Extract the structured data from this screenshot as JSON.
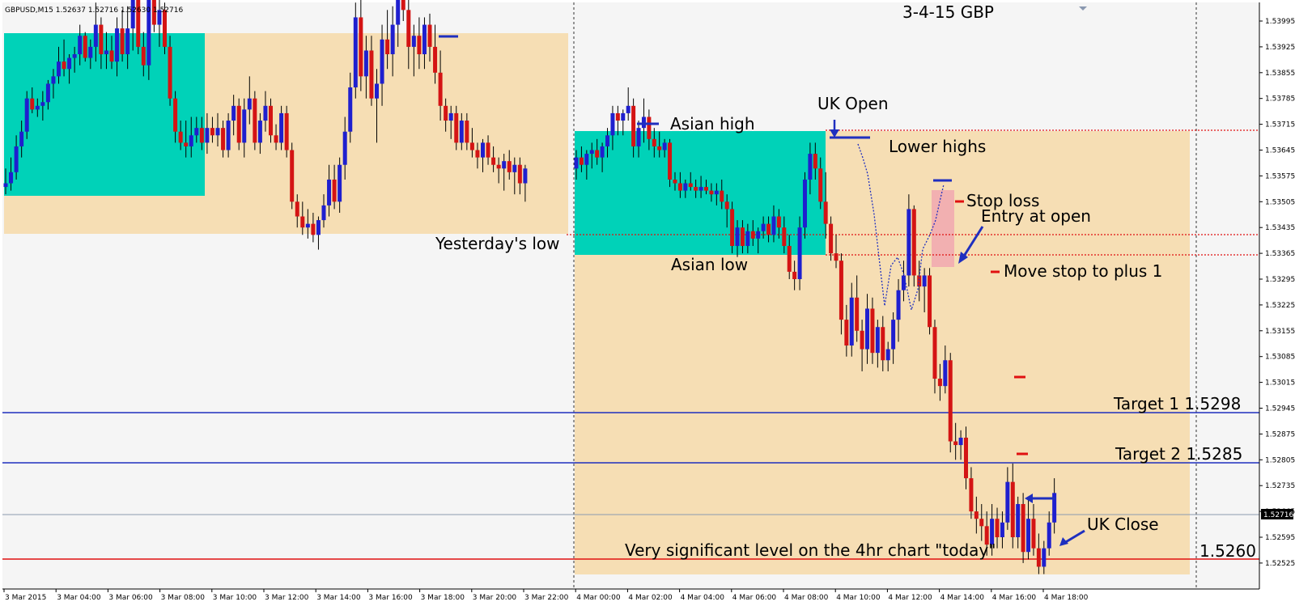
{
  "symbol_info": "GBPUSD,M15  1.52637 1.52716 1.52630 1.52716",
  "chart_title": "3-4-15  GBP",
  "colors": {
    "bull": "#1f1fcf",
    "bear": "#d41414",
    "session": "#00d2b8",
    "range": "#f6deb4",
    "bg": "#f5f5f5"
  },
  "chart_data": {
    "type": "candlestick",
    "timeframe": "M15",
    "ylim": [
      1.5251,
      1.5403
    ],
    "x_ticks": [
      "3 Mar 2015",
      "3 Mar 04:00",
      "3 Mar 06:00",
      "3 Mar 08:00",
      "3 Mar 10:00",
      "3 Mar 12:00",
      "3 Mar 14:00",
      "3 Mar 16:00",
      "3 Mar 18:00",
      "3 Mar 20:00",
      "3 Mar 22:00",
      "4 Mar 00:00",
      "4 Mar 02:00",
      "4 Mar 04:00",
      "4 Mar 06:00",
      "4 Mar 08:00",
      "4 Mar 10:00",
      "4 Mar 12:00",
      "4 Mar 14:00",
      "4 Mar 16:00",
      "4 Mar 18:00"
    ],
    "y_ticks": [
      "1.53995",
      "1.53925",
      "1.53855",
      "1.53785",
      "1.53715",
      "1.53645",
      "1.53575",
      "1.53505",
      "1.53435",
      "1.53365",
      "1.53295",
      "1.53225",
      "1.53155",
      "1.53085",
      "1.53015",
      "1.52945",
      "1.52875",
      "1.52805",
      "1.52735",
      "1.52665",
      "1.52595",
      "1.52525"
    ],
    "current_price": "1.52716",
    "levels": [
      {
        "name": "Target 1",
        "label": "Target 1  1.5298",
        "value": 1.5298
      },
      {
        "name": "Target 2",
        "label": "Target 2  1.5285",
        "value": 1.5285
      },
      {
        "name": "Very significant level",
        "label": "1.5260",
        "value": 1.526
      }
    ],
    "candles_day1": [
      [
        1.5354,
        1.5359,
        1.5352,
        1.5355
      ],
      [
        1.5355,
        1.5362,
        1.5353,
        1.5358
      ],
      [
        1.5358,
        1.5368,
        1.5356,
        1.5365
      ],
      [
        1.5365,
        1.5372,
        1.5362,
        1.5369
      ],
      [
        1.5369,
        1.538,
        1.5367,
        1.5378
      ],
      [
        1.5378,
        1.5381,
        1.5374,
        1.5375
      ],
      [
        1.5375,
        1.5378,
        1.5373,
        1.5376
      ],
      [
        1.5376,
        1.538,
        1.5372,
        1.5377
      ],
      [
        1.5377,
        1.5383,
        1.5375,
        1.5382
      ],
      [
        1.5382,
        1.5386,
        1.5378,
        1.5384
      ],
      [
        1.5384,
        1.5392,
        1.5382,
        1.5388
      ],
      [
        1.5388,
        1.5394,
        1.5384,
        1.5386
      ],
      [
        1.5386,
        1.539,
        1.5382,
        1.5389
      ],
      [
        1.5389,
        1.5392,
        1.5385,
        1.539
      ],
      [
        1.539,
        1.5398,
        1.5387,
        1.5395
      ],
      [
        1.5395,
        1.5396,
        1.5388,
        1.5389
      ],
      [
        1.5389,
        1.5394,
        1.5386,
        1.5392
      ],
      [
        1.5392,
        1.5404,
        1.5388,
        1.5398
      ],
      [
        1.5398,
        1.54,
        1.5386,
        1.539
      ],
      [
        1.539,
        1.5396,
        1.5386,
        1.5391
      ],
      [
        1.5391,
        1.5395,
        1.5386,
        1.5388
      ],
      [
        1.5388,
        1.54,
        1.5384,
        1.5397
      ],
      [
        1.5397,
        1.5402,
        1.5388,
        1.539
      ],
      [
        1.539,
        1.5403,
        1.5386,
        1.5397
      ],
      [
        1.5397,
        1.541,
        1.5391,
        1.5405
      ],
      [
        1.5405,
        1.5408,
        1.539,
        1.5392
      ],
      [
        1.5392,
        1.5396,
        1.5384,
        1.5387
      ],
      [
        1.5387,
        1.5412,
        1.5383,
        1.5408
      ],
      [
        1.5408,
        1.541,
        1.5396,
        1.5398
      ],
      [
        1.5398,
        1.5406,
        1.5392,
        1.5402
      ],
      [
        1.5402,
        1.5404,
        1.539,
        1.5392
      ],
      [
        1.5392,
        1.5395,
        1.5376,
        1.5378
      ],
      [
        1.5378,
        1.538,
        1.5366,
        1.5369
      ],
      [
        1.5369,
        1.5372,
        1.5364,
        1.5366
      ],
      [
        1.5366,
        1.5372,
        1.5362,
        1.5365
      ],
      [
        1.5365,
        1.5373,
        1.5362,
        1.5368
      ],
      [
        1.5368,
        1.5373,
        1.5366,
        1.537
      ],
      [
        1.537,
        1.5373,
        1.5364,
        1.5366
      ],
      [
        1.5366,
        1.5374,
        1.5363,
        1.537
      ],
      [
        1.537,
        1.5373,
        1.5366,
        1.5368
      ],
      [
        1.5368,
        1.5374,
        1.5365,
        1.537
      ],
      [
        1.537,
        1.5372,
        1.5362,
        1.5364
      ],
      [
        1.5364,
        1.5374,
        1.5362,
        1.5372
      ],
      [
        1.5372,
        1.5379,
        1.5368,
        1.5376
      ],
      [
        1.5376,
        1.5378,
        1.5364,
        1.5366
      ],
      [
        1.5366,
        1.5378,
        1.5362,
        1.5375
      ],
      [
        1.5375,
        1.5384,
        1.5371,
        1.5378
      ],
      [
        1.5378,
        1.538,
        1.5364,
        1.5366
      ],
      [
        1.5366,
        1.5374,
        1.5363,
        1.5372
      ],
      [
        1.5372,
        1.538,
        1.5369,
        1.5376
      ],
      [
        1.5376,
        1.5378,
        1.5366,
        1.5368
      ],
      [
        1.5368,
        1.5371,
        1.5364,
        1.5366
      ],
      [
        1.5366,
        1.5376,
        1.5364,
        1.5374
      ],
      [
        1.5374,
        1.5376,
        1.5362,
        1.5364
      ],
      [
        1.5364,
        1.5366,
        1.5348,
        1.535
      ],
      [
        1.535,
        1.5352,
        1.5343,
        1.5346
      ],
      [
        1.5346,
        1.535,
        1.5341,
        1.5343
      ],
      [
        1.5343,
        1.5348,
        1.534,
        1.5344
      ],
      [
        1.5344,
        1.5347,
        1.5339,
        1.5341
      ],
      [
        1.5341,
        1.5346,
        1.5337,
        1.5345
      ],
      [
        1.5345,
        1.5352,
        1.5343,
        1.5349
      ],
      [
        1.5349,
        1.536,
        1.5346,
        1.5356
      ],
      [
        1.5356,
        1.536,
        1.5348,
        1.535
      ],
      [
        1.535,
        1.5362,
        1.5347,
        1.536
      ],
      [
        1.536,
        1.5373,
        1.5356,
        1.5369
      ],
      [
        1.5369,
        1.5385,
        1.5366,
        1.5381
      ],
      [
        1.5381,
        1.5404,
        1.5378,
        1.54
      ],
      [
        1.54,
        1.5405,
        1.538,
        1.5384
      ],
      [
        1.5384,
        1.5395,
        1.5378,
        1.5391
      ],
      [
        1.5391,
        1.5395,
        1.5376,
        1.5378
      ],
      [
        1.5378,
        1.5386,
        1.5366,
        1.5382
      ],
      [
        1.5382,
        1.5398,
        1.5376,
        1.5394
      ],
      [
        1.5394,
        1.5402,
        1.5386,
        1.539
      ],
      [
        1.539,
        1.5403,
        1.5384,
        1.5398
      ],
      [
        1.5398,
        1.5418,
        1.5392,
        1.5414
      ],
      [
        1.5414,
        1.542,
        1.5399,
        1.5402
      ],
      [
        1.5402,
        1.5407,
        1.5386,
        1.5392
      ],
      [
        1.5392,
        1.5398,
        1.5384,
        1.5395
      ],
      [
        1.5395,
        1.54,
        1.5386,
        1.539
      ],
      [
        1.539,
        1.54,
        1.5386,
        1.5398
      ],
      [
        1.5398,
        1.5401,
        1.5388,
        1.5392
      ],
      [
        1.5392,
        1.5398,
        1.5382,
        1.5385
      ],
      [
        1.5385,
        1.5391,
        1.5372,
        1.5376
      ],
      [
        1.5376,
        1.5378,
        1.5369,
        1.5372
      ],
      [
        1.5372,
        1.5376,
        1.5367,
        1.5374
      ],
      [
        1.5374,
        1.5376,
        1.5364,
        1.5366
      ],
      [
        1.5366,
        1.5374,
        1.5364,
        1.5372
      ],
      [
        1.5372,
        1.5374,
        1.5364,
        1.5366
      ],
      [
        1.5366,
        1.537,
        1.5362,
        1.5364
      ],
      [
        1.5364,
        1.5366,
        1.5359,
        1.5362
      ],
      [
        1.5362,
        1.5367,
        1.5358,
        1.5366
      ],
      [
        1.5366,
        1.5368,
        1.536,
        1.5362
      ],
      [
        1.5362,
        1.5365,
        1.5358,
        1.536
      ],
      [
        1.536,
        1.5362,
        1.5355,
        1.5359
      ],
      [
        1.5359,
        1.5363,
        1.5353,
        1.5361
      ],
      [
        1.5361,
        1.5364,
        1.5356,
        1.5358
      ],
      [
        1.5358,
        1.5362,
        1.5352,
        1.536
      ],
      [
        1.536,
        1.5362,
        1.5352,
        1.5355
      ],
      [
        1.5355,
        1.536,
        1.535,
        1.5359
      ]
    ],
    "candles_day2": [
      [
        1.5359,
        1.5364,
        1.5356,
        1.5362
      ],
      [
        1.5362,
        1.5365,
        1.5358,
        1.536
      ],
      [
        1.536,
        1.5364,
        1.5356,
        1.5363
      ],
      [
        1.5363,
        1.5366,
        1.5359,
        1.5364
      ],
      [
        1.5364,
        1.5367,
        1.536,
        1.5362
      ],
      [
        1.5362,
        1.5366,
        1.5358,
        1.5365
      ],
      [
        1.5365,
        1.537,
        1.5362,
        1.5368
      ],
      [
        1.5368,
        1.5376,
        1.5364,
        1.5374
      ],
      [
        1.5374,
        1.5376,
        1.5368,
        1.5372
      ],
      [
        1.5372,
        1.5375,
        1.5368,
        1.5374
      ],
      [
        1.5374,
        1.5381,
        1.5372,
        1.5376
      ],
      [
        1.5376,
        1.5378,
        1.5362,
        1.5365
      ],
      [
        1.5365,
        1.5372,
        1.5362,
        1.537
      ],
      [
        1.537,
        1.5378,
        1.5366,
        1.5373
      ],
      [
        1.5373,
        1.5375,
        1.5364,
        1.5367
      ],
      [
        1.5367,
        1.537,
        1.5362,
        1.5365
      ],
      [
        1.5365,
        1.5369,
        1.5362,
        1.5364
      ],
      [
        1.5364,
        1.5367,
        1.5362,
        1.5366
      ],
      [
        1.5366,
        1.5367,
        1.5354,
        1.5356
      ],
      [
        1.5356,
        1.5358,
        1.5353,
        1.5355
      ],
      [
        1.5355,
        1.5358,
        1.5351,
        1.5353
      ],
      [
        1.5353,
        1.5356,
        1.5351,
        1.5355
      ],
      [
        1.5355,
        1.5358,
        1.5353,
        1.5354
      ],
      [
        1.5354,
        1.5356,
        1.5351,
        1.5353
      ],
      [
        1.5353,
        1.5357,
        1.5351,
        1.5354
      ],
      [
        1.5354,
        1.5356,
        1.5352,
        1.5353
      ],
      [
        1.5353,
        1.5355,
        1.535,
        1.5352
      ],
      [
        1.5352,
        1.5355,
        1.5349,
        1.5353
      ],
      [
        1.5353,
        1.5356,
        1.5348,
        1.535
      ],
      [
        1.535,
        1.5352,
        1.5343,
        1.5348
      ],
      [
        1.5348,
        1.535,
        1.5336,
        1.5338
      ],
      [
        1.5338,
        1.5345,
        1.5335,
        1.5343
      ],
      [
        1.5343,
        1.5345,
        1.5336,
        1.5338
      ],
      [
        1.5338,
        1.5344,
        1.5336,
        1.5342
      ],
      [
        1.5342,
        1.5345,
        1.5338,
        1.534
      ],
      [
        1.534,
        1.5343,
        1.5336,
        1.5342
      ],
      [
        1.5342,
        1.5346,
        1.534,
        1.5344
      ],
      [
        1.5344,
        1.5346,
        1.5339,
        1.5341
      ],
      [
        1.5341,
        1.5349,
        1.5339,
        1.5346
      ],
      [
        1.5346,
        1.5348,
        1.534,
        1.5343
      ],
      [
        1.5343,
        1.5346,
        1.5336,
        1.5338
      ],
      [
        1.5338,
        1.5341,
        1.5329,
        1.5331
      ],
      [
        1.5331,
        1.5334,
        1.5326,
        1.5329
      ],
      [
        1.5329,
        1.5346,
        1.5326,
        1.5343
      ],
      [
        1.5343,
        1.5358,
        1.534,
        1.5356
      ],
      [
        1.5356,
        1.5366,
        1.5352,
        1.5363
      ],
      [
        1.5363,
        1.5366,
        1.5356,
        1.5359
      ],
      [
        1.5359,
        1.5362,
        1.5348,
        1.535
      ],
      [
        1.535,
        1.5358,
        1.534,
        1.5344
      ],
      [
        1.5344,
        1.5346,
        1.5334,
        1.5336
      ],
      [
        1.5336,
        1.5341,
        1.5332,
        1.5334
      ],
      [
        1.5334,
        1.5336,
        1.5314,
        1.5318
      ],
      [
        1.5318,
        1.5322,
        1.5308,
        1.5311
      ],
      [
        1.5311,
        1.5328,
        1.5308,
        1.5324
      ],
      [
        1.5324,
        1.533,
        1.5312,
        1.5315
      ],
      [
        1.5315,
        1.5318,
        1.5304,
        1.531
      ],
      [
        1.531,
        1.5325,
        1.5306,
        1.5321
      ],
      [
        1.5321,
        1.5324,
        1.5306,
        1.5309
      ],
      [
        1.5309,
        1.5318,
        1.5305,
        1.5316
      ],
      [
        1.5316,
        1.5319,
        1.5304,
        1.5307
      ],
      [
        1.5307,
        1.5312,
        1.5304,
        1.531
      ],
      [
        1.531,
        1.532,
        1.5306,
        1.5318
      ],
      [
        1.5318,
        1.5329,
        1.5312,
        1.5326
      ],
      [
        1.5326,
        1.5334,
        1.5323,
        1.533
      ],
      [
        1.533,
        1.5352,
        1.5327,
        1.5348
      ],
      [
        1.5348,
        1.5349,
        1.5327,
        1.533
      ],
      [
        1.533,
        1.5334,
        1.5323,
        1.5327
      ],
      [
        1.5327,
        1.5332,
        1.532,
        1.533
      ],
      [
        1.533,
        1.5332,
        1.5314,
        1.5316
      ],
      [
        1.5316,
        1.5318,
        1.5298,
        1.5302
      ],
      [
        1.5302,
        1.5306,
        1.5296,
        1.53
      ],
      [
        1.53,
        1.5311,
        1.5298,
        1.5307
      ],
      [
        1.5307,
        1.5309,
        1.5282,
        1.5285
      ],
      [
        1.5285,
        1.529,
        1.528,
        1.5284
      ],
      [
        1.5284,
        1.5288,
        1.528,
        1.5286
      ],
      [
        1.5286,
        1.5289,
        1.5272,
        1.5275
      ],
      [
        1.5275,
        1.5278,
        1.5264,
        1.5266
      ],
      [
        1.5266,
        1.527,
        1.526,
        1.5264
      ],
      [
        1.5264,
        1.5268,
        1.5258,
        1.5262
      ],
      [
        1.5262,
        1.5266,
        1.5254,
        1.5257
      ],
      [
        1.5257,
        1.5268,
        1.5254,
        1.5264
      ],
      [
        1.5264,
        1.5267,
        1.5256,
        1.5259
      ],
      [
        1.5259,
        1.5266,
        1.5256,
        1.5263
      ],
      [
        1.5263,
        1.5278,
        1.5261,
        1.5274
      ],
      [
        1.5274,
        1.5279,
        1.5256,
        1.5259
      ],
      [
        1.5259,
        1.527,
        1.5256,
        1.5268
      ],
      [
        1.5268,
        1.5271,
        1.5252,
        1.5255
      ],
      [
        1.5255,
        1.527,
        1.5253,
        1.5264
      ],
      [
        1.5264,
        1.5268,
        1.5254,
        1.5256
      ],
      [
        1.5256,
        1.526,
        1.5249,
        1.5251
      ],
      [
        1.5251,
        1.5258,
        1.5249,
        1.5256
      ],
      [
        1.5256,
        1.5266,
        1.5254,
        1.5263
      ],
      [
        1.5263,
        1.5275,
        1.526,
        1.5271
      ]
    ],
    "annotations": {
      "uk_open": "UK Open",
      "asian_high": "Asian high",
      "lower_highs": "Lower highs",
      "stop_loss": "Stop loss",
      "entry": "Entry at open",
      "yesterdays_low": "Yesterday's low",
      "asian_low": "Asian low",
      "move_stop": "Move stop to plus 1",
      "uk_close": "UK Close",
      "significant": "Very significant level on the 4hr chart \"today\""
    }
  }
}
